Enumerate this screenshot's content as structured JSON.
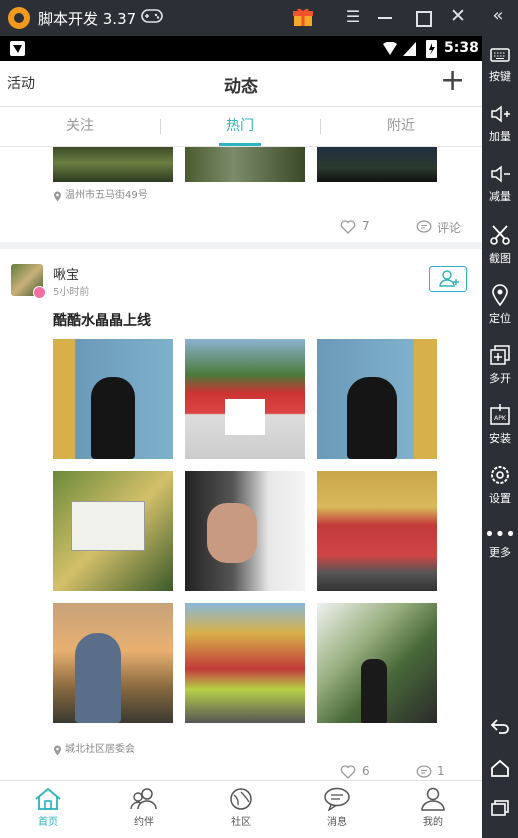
{
  "emulator": {
    "title": "脚本开发 3.37",
    "sidebar": [
      {
        "icon": "keyboard-icon",
        "label": "按键"
      },
      {
        "icon": "volume-up-icon",
        "label": "加量"
      },
      {
        "icon": "volume-down-icon",
        "label": "减量"
      },
      {
        "icon": "scissors-icon",
        "label": "截图"
      },
      {
        "icon": "location-pin-icon",
        "label": "定位"
      },
      {
        "icon": "multi-window-icon",
        "label": "多开"
      },
      {
        "icon": "apk-install-icon",
        "label": "安装"
      },
      {
        "icon": "gear-icon",
        "label": "设置"
      },
      {
        "icon": "more-dots-icon",
        "label": "更多"
      }
    ]
  },
  "status": {
    "time": "5:38"
  },
  "appbar": {
    "left": "活动",
    "title": "动态",
    "add": "+"
  },
  "tabs": [
    {
      "label": "关注",
      "active": false
    },
    {
      "label": "热门",
      "active": true
    },
    {
      "label": "附近",
      "active": false
    }
  ],
  "post1": {
    "location": "温州市五马街49号",
    "likes": "7",
    "comment_label": "评论"
  },
  "post2": {
    "username": "啾宝",
    "time": "5小时前",
    "text": "酷酷水晶晶上线",
    "location": "城北社区居委会",
    "likes": "6",
    "comments": "1"
  },
  "bottom_nav": [
    {
      "label": "首页",
      "icon": "home-icon",
      "active": true
    },
    {
      "label": "约伴",
      "icon": "companions-icon",
      "active": false
    },
    {
      "label": "社区",
      "icon": "community-icon",
      "active": false
    },
    {
      "label": "消息",
      "icon": "message-icon",
      "active": false
    },
    {
      "label": "我的",
      "icon": "profile-icon",
      "active": false
    }
  ],
  "colors": {
    "accent": "#2bb3c0",
    "emulator_bg": "#2c2f36"
  }
}
